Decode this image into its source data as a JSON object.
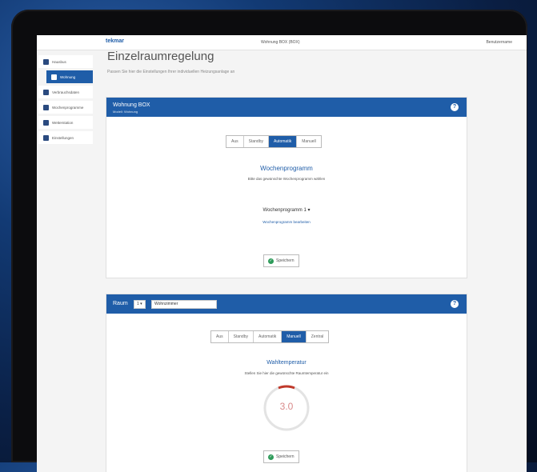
{
  "topbar": {
    "brand": "tekmar",
    "apartment": "Wohnung BOX (BOX)",
    "user": "Benutzername"
  },
  "sidebar": {
    "items": [
      {
        "label": "Hausbus",
        "icon": "back-arrow-icon",
        "active": false
      },
      {
        "label": "Wohnung",
        "icon": "home-icon",
        "active": true
      },
      {
        "label": "Verbrauchsdaten",
        "icon": "meter-icon",
        "active": false
      },
      {
        "label": "Wochenprogramme",
        "icon": "calendar-icon",
        "active": false
      },
      {
        "label": "Wetterstation",
        "icon": "weather-icon",
        "active": false
      },
      {
        "label": "Einstellungen",
        "icon": "gear-icon",
        "active": false
      }
    ]
  },
  "page": {
    "title": "Einzelraumregelung",
    "subtitle": "Passen Sie hier die Einstellungen Ihrer individuellen Heizungsanlage an"
  },
  "panel1": {
    "title": "Wohnung BOX",
    "subtitle": "Modell: Wohnung",
    "modes": [
      "Aus",
      "Standby",
      "Automatik",
      "Manuell"
    ],
    "active_mode": "Automatik",
    "section_title": "Wochenprogramm",
    "section_desc": "Bitte das gewünschte Wochenprogramm wählen",
    "program": "Wochenprogramm 1 ▾",
    "program_link": "Wochenprogramm bearbeiten",
    "save": "Speichern"
  },
  "panel2": {
    "room_label": "Raum",
    "room_number": "1 ▾",
    "room_name": "Wohnzimmer",
    "modes": [
      "Aus",
      "Standby",
      "Automatik",
      "Manuell",
      "Zentral"
    ],
    "active_mode": "Manuell",
    "section_title": "Wahltemperatur",
    "section_desc": "Stellen Sie hier die gewünschte Raumtemperatur ein",
    "value": "3.0",
    "save": "Speichern"
  }
}
